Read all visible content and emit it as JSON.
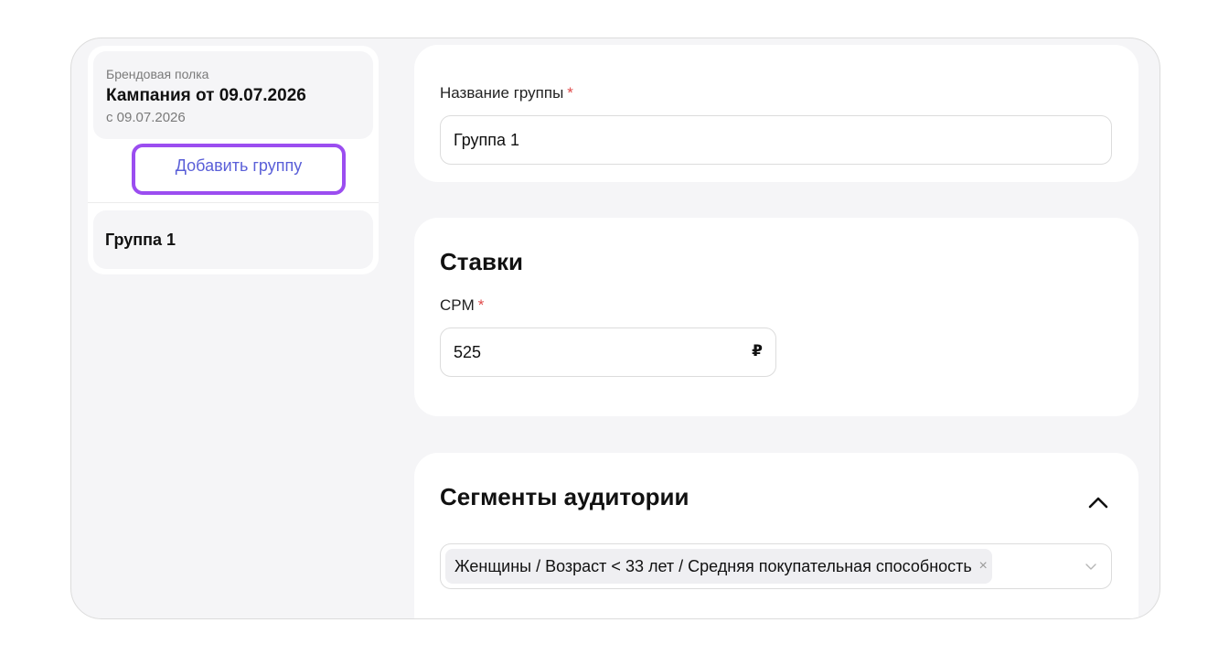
{
  "sidebar": {
    "campaign": {
      "type": "Брендовая полка",
      "name": "Кампания от 09.07.2026",
      "date": "с 09.07.2026"
    },
    "add_group_label": "Добавить группу",
    "groups": [
      {
        "label": "Группа 1"
      }
    ]
  },
  "group_name": {
    "label": "Название группы",
    "required_mark": "*",
    "value": "Группа 1"
  },
  "bids": {
    "title": "Ставки",
    "cpm_label": "CPM",
    "required_mark": "*",
    "cpm_value": "525",
    "currency": "₽"
  },
  "segments": {
    "title": "Сегменты аудитории",
    "selected_tag": "Женщины / Возраст < 33 лет / Средняя покупательная способность",
    "tag_remove": "×"
  },
  "colors": {
    "accent_outline": "#9b4df0",
    "link": "#5a5fd8",
    "required": "#e04a4a",
    "background": "#f5f5f7"
  },
  "icons": {
    "collapse": "chevron-up-icon",
    "select": "chevron-down-icon",
    "remove": "close-icon"
  }
}
